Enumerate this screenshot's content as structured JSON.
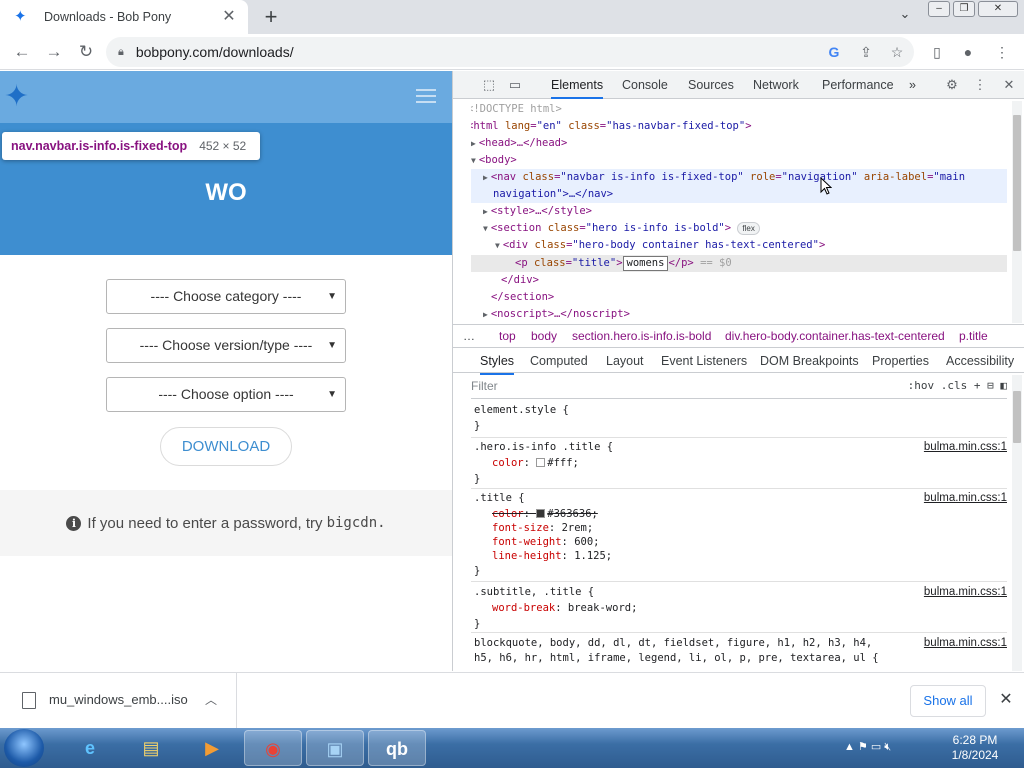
{
  "browser": {
    "tab_title": "Downloads - Bob Pony",
    "tab_close": "✕",
    "new_tab": "+",
    "url": "bobpony.com/downloads/"
  },
  "page": {
    "tooltip_selector": "nav.navbar.is-info.is-fixed-top",
    "tooltip_size": "452 × 52",
    "hero_title": "wo",
    "selects": [
      {
        "label": "---- Choose category ----"
      },
      {
        "label": "---- Choose version/type ----"
      },
      {
        "label": "---- Choose option ----"
      }
    ],
    "download_label": "DOWNLOAD",
    "notice_text": "If you need to enter a password, try",
    "notice_code": "bigcdn."
  },
  "devtools": {
    "tabs": [
      "Elements",
      "Console",
      "Sources",
      "Network",
      "Performance",
      "»"
    ],
    "dom": {
      "doctype": "<!DOCTYPE html>",
      "html_open": "<html",
      "html_lang_attr": "lang",
      "html_lang_val": "\"en\"",
      "html_class_attr": "class",
      "html_class_val": "\"has-navbar-fixed-top\"",
      "head": "<head>…</head>",
      "body": "<body>",
      "nav_tag": "<nav",
      "nav_class": "\"navbar is-info is-fixed-top\"",
      "nav_role": "\"navigation\"",
      "nav_aria": "\"main",
      "nav_cont": "navigation\">…</nav>",
      "style": "<style>…</style>",
      "section_tag": "<section",
      "section_class": "\"hero is-info is-bold\"",
      "flex_badge": "flex",
      "div_tag": "<div",
      "div_class": "\"hero-body container has-text-centered\"",
      "p_tag": "<p",
      "p_class": "\"title\"",
      "p_edit": "womens",
      "p_close": "</p>",
      "p_eq": "== $0",
      "div_close": "</div>",
      "section_close": "</section>",
      "noscript": "<noscript>…</noscript>",
      "ellipsis": "…",
      "attr_class": "class",
      "attr_role": "role",
      "attr_aria": "aria-label"
    },
    "breadcrumbs": [
      "…",
      "top",
      "body",
      "section.hero.is-info.is-bold",
      "div.hero-body.container.has-text-centered",
      "p.title"
    ],
    "subtabs": [
      "Styles",
      "Computed",
      "Layout",
      "Event Listeners",
      "DOM Breakpoints",
      "Properties",
      "Accessibility"
    ],
    "filter_placeholder": "Filter",
    "filter_tools": ":hov  .cls",
    "rules": {
      "r1_sel": "element.style {",
      "close": "}",
      "r2_sel": ".hero.is-info .title {",
      "r2_p1_name": "color",
      "r2_p1_val": "#fff;",
      "r3_sel": ".title {",
      "r3_p1_name": "color",
      "r3_p1_val": "#363636;",
      "r3_p2_name": "font-size",
      "r3_p2_val": "2rem;",
      "r3_p3_name": "font-weight",
      "r3_p3_val": "600;",
      "r3_p4_name": "line-height",
      "r3_p4_val": "1.125;",
      "r4_sel": ".subtitle, .title {",
      "r4_p1_name": "word-break",
      "r4_p1_val": "break-word;",
      "r5_sel": "blockquote, body, dd, dl, dt, fieldset, figure, h1, h2, h3, h4,",
      "r5_sel2": "h5, h6, hr, html, iframe, legend, li, ol, p, pre, textarea, ul {",
      "source": "bulma.min.css:1"
    },
    "colors": {
      "tag": "#881280",
      "attr_name": "#994500",
      "attr_value": "#1a1aa6"
    }
  },
  "downloads": {
    "file_name": "mu_windows_emb....iso",
    "show_all": "Show all"
  },
  "taskbar": {
    "time": "6:28 PM",
    "date": "1/8/2024"
  },
  "colors": {
    "hero": "#3e8ed0",
    "navbar_highlight": "#6aaae0",
    "link": "#1a73e8"
  }
}
